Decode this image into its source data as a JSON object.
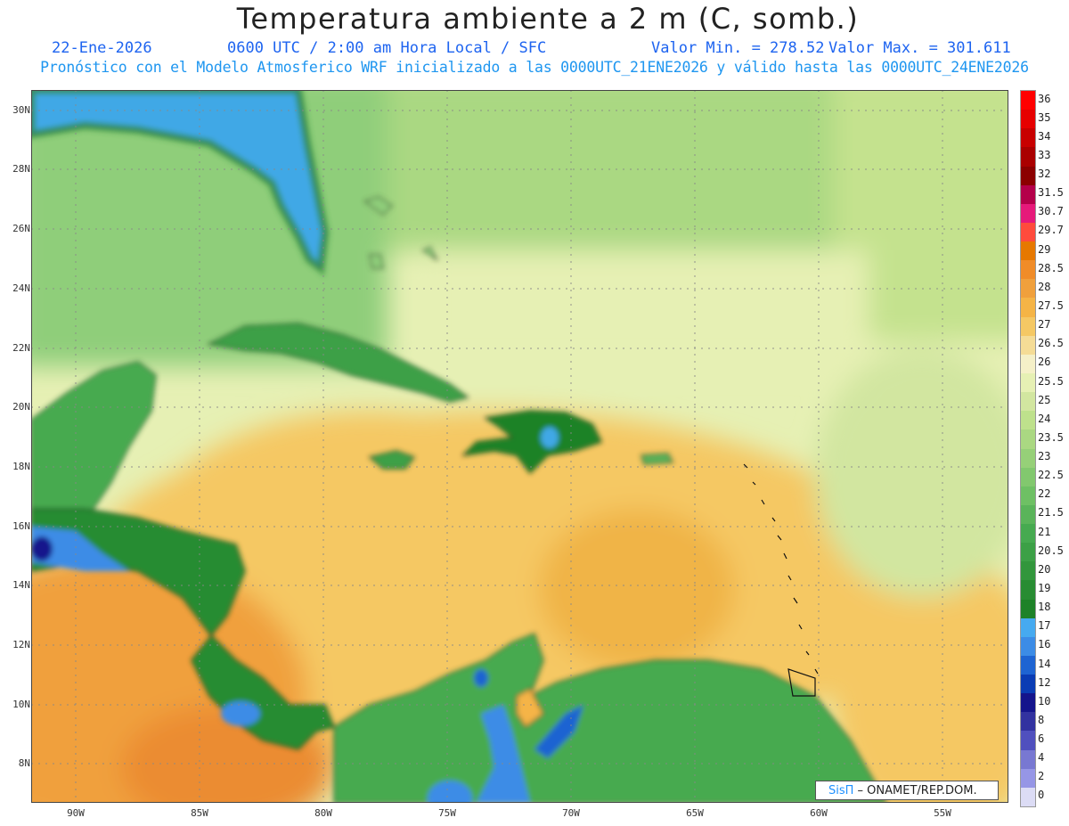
{
  "title": "Temperatura ambiente a 2 m (C, somb.)",
  "info": {
    "date": "22-Ene-2026",
    "time": "0600 UTC / 2:00 am Hora Local / SFC",
    "min": "Valor Min. = 278.52",
    "max": "Valor Max. = 301.611",
    "forecast": "Pronóstico con el Modelo Atmosferico WRF inicializado a las 0000UTC_21ENE2026 y válido hasta las  0000UTC_24ENE2026"
  },
  "axes": {
    "lat_labels": [
      "30N",
      "28N",
      "26N",
      "24N",
      "22N",
      "20N",
      "18N",
      "16N",
      "14N",
      "12N",
      "10N",
      "8N"
    ],
    "lon_labels": [
      "90W",
      "85W",
      "80W",
      "75W",
      "70W",
      "65W",
      "60W",
      "55W"
    ]
  },
  "legend": {
    "levels": [
      "36",
      "35",
      "34",
      "33",
      "32",
      "31.5",
      "30.7",
      "29.7",
      "29",
      "28.5",
      "28",
      "27.5",
      "27",
      "26.5",
      "26",
      "25.5",
      "25",
      "24",
      "23.5",
      "23",
      "22.5",
      "22",
      "21.5",
      "21",
      "20.5",
      "20",
      "19",
      "18",
      "17",
      "16",
      "14",
      "12",
      "10",
      "8",
      "6",
      "4",
      "2",
      "0"
    ],
    "colors": [
      "#ff0000",
      "#e60000",
      "#c80000",
      "#aa0000",
      "#8b0000",
      "#b4004a",
      "#e6197a",
      "#ff4b3c",
      "#e67800",
      "#f08c28",
      "#f0a03c",
      "#f5b446",
      "#f5c864",
      "#f5dc96",
      "#f5f0c8",
      "#e6f0b4",
      "#d2e6a0",
      "#bee18c",
      "#aad882",
      "#96d078",
      "#82c86e",
      "#6ec064",
      "#5ab45a",
      "#46aa50",
      "#3ca046",
      "#32963c",
      "#288c32",
      "#1e8228",
      "#46aaf0",
      "#3c8ce6",
      "#1e64d2",
      "#0a3cb4",
      "#14148c",
      "#3232a0",
      "#5050be",
      "#7878d2",
      "#9696e6",
      "#dcdcf5"
    ]
  },
  "map": {
    "land_colors": {
      "florida": "#41a8e6",
      "cuba": "#3ca046",
      "hispaniola": "#1e8228",
      "central_america": "#288c32",
      "south_america": "#46aa50"
    },
    "sea_colors": {
      "north": "#aad882",
      "atlantic": "#e6f0b4",
      "caribbean": "#f5c864",
      "pacific": "#f0a03c"
    }
  },
  "credit": {
    "brand": "SisΠ",
    "text": " – ONAMET/REP.DOM."
  }
}
